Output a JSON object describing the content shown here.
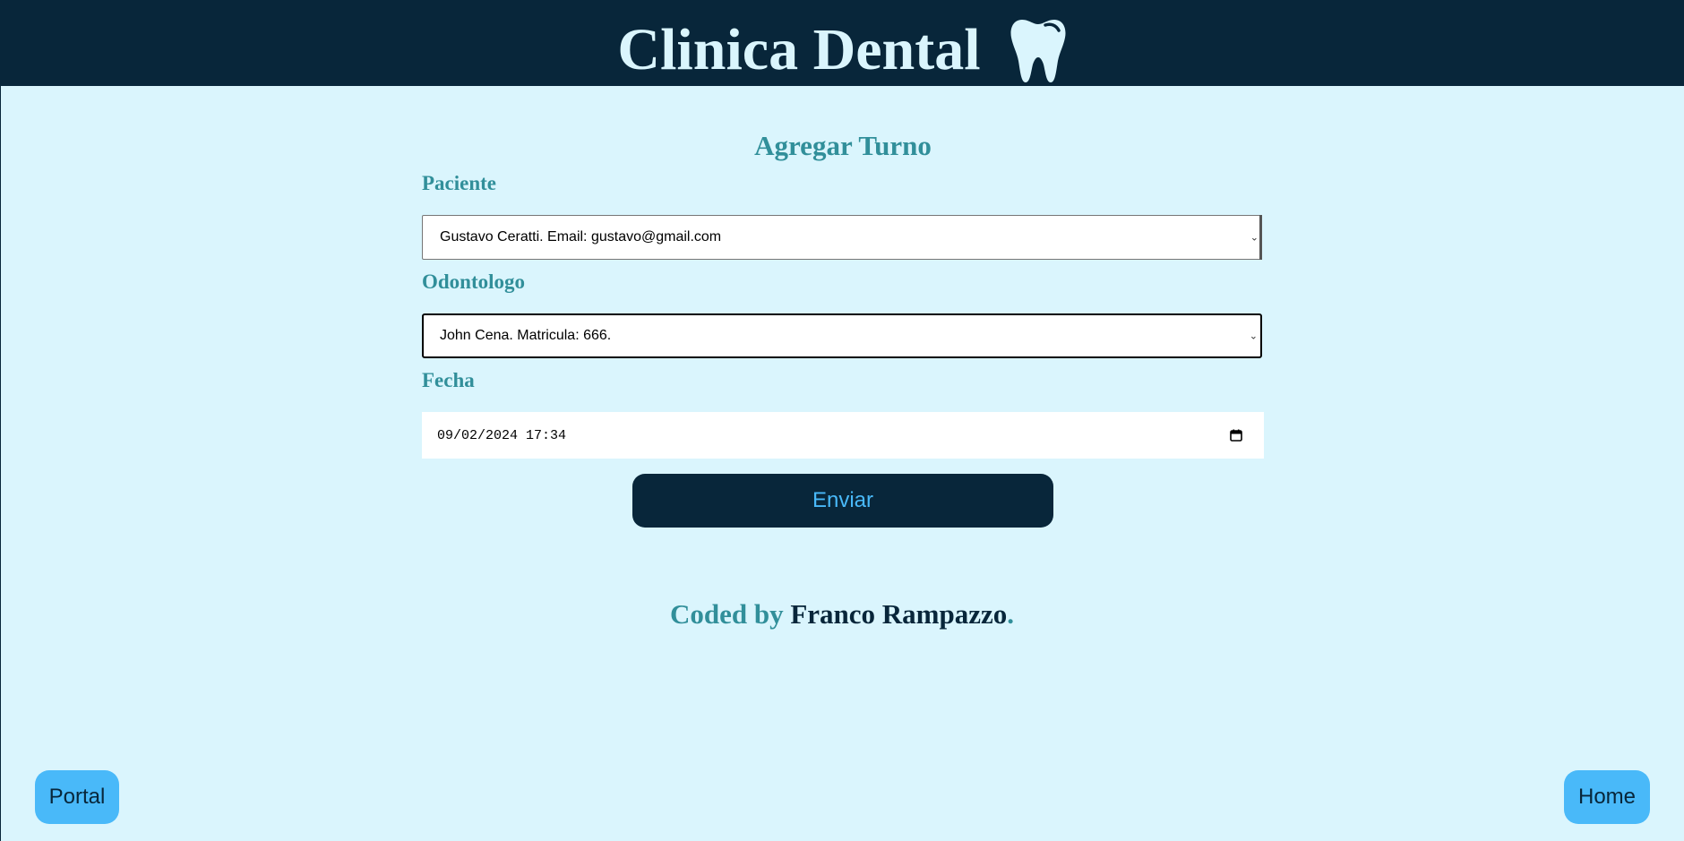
{
  "header": {
    "title": "Clinica Dental",
    "icon": "tooth-icon"
  },
  "form": {
    "title": "Agregar Turno",
    "paciente_label": "Paciente",
    "paciente_value": "Gustavo Ceratti. Email: gustavo@gmail.com",
    "odontologo_label": "Odontologo",
    "odontologo_value": "John Cena. Matricula: 666.",
    "fecha_label": "Fecha",
    "fecha_value": "09/02/2024 17:34",
    "submit_label": "Enviar"
  },
  "footer": {
    "prefix": "Coded by",
    "author": "Franco Rampazzo",
    "suffix": "."
  },
  "nav": {
    "portal_label": "Portal",
    "home_label": "Home"
  },
  "colors": {
    "navy": "#08263a",
    "background": "#daf5fd",
    "teal": "#318f9a",
    "accent_blue": "#49b9f9"
  }
}
